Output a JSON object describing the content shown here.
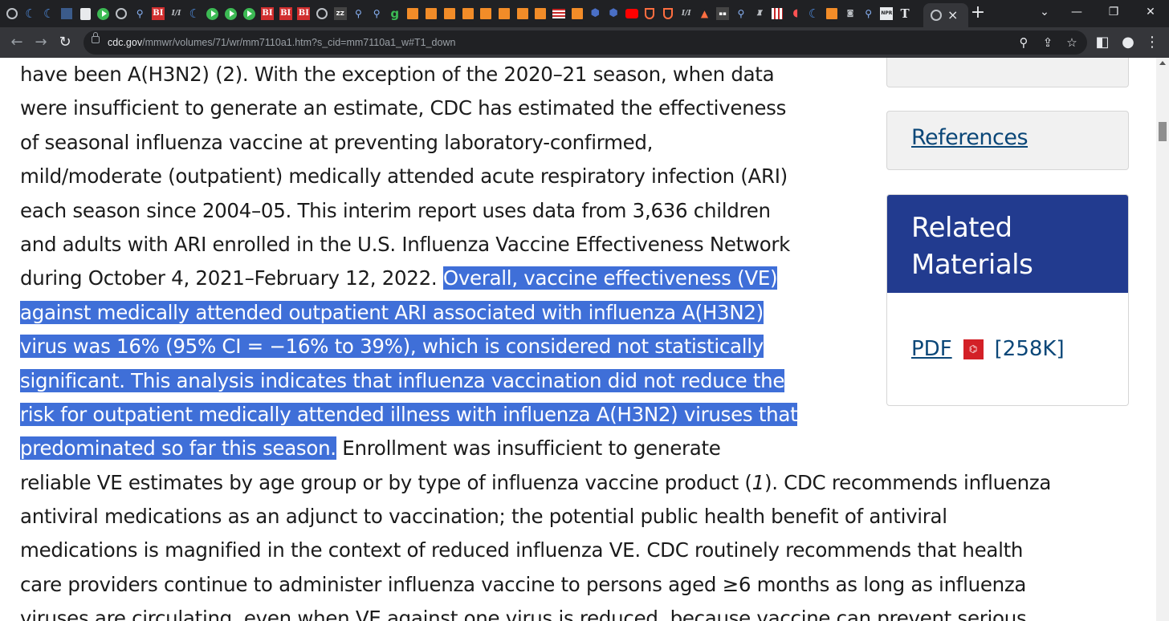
{
  "browser": {
    "pinned_tabs": [
      {
        "icon": "globe-icon",
        "text": ""
      },
      {
        "icon": "cdc-icon",
        "text": "☾"
      },
      {
        "icon": "cdc-icon",
        "text": "☾"
      },
      {
        "icon": "flag-icon",
        "text": ""
      },
      {
        "icon": "sheet-icon",
        "text": ""
      },
      {
        "icon": "play-icon",
        "text": ""
      },
      {
        "icon": "globe-icon",
        "text": ""
      },
      {
        "icon": "search-icon",
        "text": "⚲"
      },
      {
        "icon": "bi-icon",
        "text": "BI"
      },
      {
        "icon": "italic-icon",
        "text": "I/I"
      },
      {
        "icon": "cdc-icon",
        "text": "☾"
      },
      {
        "icon": "play-icon",
        "text": ""
      },
      {
        "icon": "play-icon",
        "text": ""
      },
      {
        "icon": "play-icon",
        "text": ""
      },
      {
        "icon": "bi-icon",
        "text": "BI"
      },
      {
        "icon": "bi-icon",
        "text": "BI"
      },
      {
        "icon": "bi-icon",
        "text": "BI"
      },
      {
        "icon": "globe-icon",
        "text": ""
      },
      {
        "icon": "dark-icon",
        "text": "ZZ"
      },
      {
        "icon": "search-icon",
        "text": "⚲"
      },
      {
        "icon": "search-icon",
        "text": "⚲"
      },
      {
        "icon": "g-icon",
        "text": "g"
      },
      {
        "icon": "bookmark-icon",
        "text": ""
      },
      {
        "icon": "bookmark-icon",
        "text": ""
      },
      {
        "icon": "bookmark-icon",
        "text": ""
      },
      {
        "icon": "bookmark-icon",
        "text": ""
      },
      {
        "icon": "bookmark-icon",
        "text": ""
      },
      {
        "icon": "bookmark-icon",
        "text": ""
      },
      {
        "icon": "bookmark-icon",
        "text": ""
      },
      {
        "icon": "bookmark-icon",
        "text": ""
      },
      {
        "icon": "usflag-icon",
        "text": ""
      },
      {
        "icon": "bookmark-icon",
        "text": ""
      },
      {
        "icon": "hex-icon",
        "text": "⬢"
      },
      {
        "icon": "hex-icon",
        "text": "⬢"
      },
      {
        "icon": "youtube-icon",
        "text": ""
      },
      {
        "icon": "shield-icon",
        "text": ""
      },
      {
        "icon": "shield-icon",
        "text": ""
      },
      {
        "icon": "italic-icon",
        "text": "I/I"
      },
      {
        "icon": "fire-icon",
        "text": "▲"
      },
      {
        "icon": "dark-icon",
        "text": "▪▪"
      },
      {
        "icon": "search-icon",
        "text": "⚲"
      },
      {
        "icon": "italic-icon",
        "text": "♜"
      },
      {
        "icon": "bars-icon",
        "text": ""
      },
      {
        "icon": "red-icon",
        "text": "◖"
      },
      {
        "icon": "cdc-icon",
        "text": "☾"
      },
      {
        "icon": "bookmark-icon",
        "text": ""
      },
      {
        "icon": "italic-icon",
        "text": "◙"
      },
      {
        "icon": "search-icon",
        "text": "⚲"
      },
      {
        "icon": "bw-icon",
        "text": "NPR"
      },
      {
        "icon": "nyt-icon",
        "text": "T"
      }
    ],
    "active_tab": {
      "icon": "globe-icon",
      "close": "×"
    },
    "new_tab": "+",
    "tab_search": "⌄",
    "window_controls": {
      "minimize": "—",
      "restore": "❐",
      "close": "✕"
    },
    "nav": {
      "back": "←",
      "forward": "→",
      "reload": "↻"
    },
    "url": {
      "host": "cdc.gov",
      "path": "/mmwr/volumes/71/wr/mm7110a1.htm?s_cid=mm7110a1_w#T1_down"
    },
    "omnibox_icons": {
      "zoom": "⚲",
      "share": "⇪",
      "bookmark": "☆"
    },
    "toolbar_icons": {
      "sidepanel": "◧",
      "profile": "●",
      "menu": "⋮"
    }
  },
  "article": {
    "lines": [
      [
        {
          "t": "have been A(H3N2) (2). With the exception of the 2020–21 season, when data"
        }
      ],
      [
        {
          "t": "were insufficient to generate an estimate, CDC has estimated the effectiveness"
        }
      ],
      [
        {
          "t": "of seasonal influenza vaccine at preventing laboratory-confirmed,"
        }
      ],
      [
        {
          "t": "mild/moderate (outpatient) medically attended acute respiratory infection (ARI)"
        }
      ],
      [
        {
          "t": "each season since 2004–05. This interim report uses data from 3,636 children"
        }
      ],
      [
        {
          "t": "and adults with ARI enrolled in the U.S. Influenza Vaccine Effectiveness Network"
        }
      ],
      [
        {
          "t": "during October 4, 2021–February 12, 2022. "
        },
        {
          "t": "Overall, vaccine effectiveness (VE)",
          "hl": true
        }
      ],
      [
        {
          "t": "against medically attended outpatient ARI associated with influenza A(H3N2)",
          "hl": true
        }
      ],
      [
        {
          "t": "virus was 16% (95% CI = −16% to 39%), which is considered not statistically",
          "hl": true
        }
      ],
      [
        {
          "t": "significant. This analysis indicates that influenza vaccination did not reduce the",
          "hl": true
        }
      ],
      [
        {
          "t": "risk for outpatient medically attended illness with influenza A(H3N2) viruses that",
          "hl": true
        }
      ],
      [
        {
          "t": "predominated so far this season.",
          "hl": true
        },
        {
          "t": " Enrollment was insufficient to generate"
        }
      ],
      [
        {
          "t": "reliable VE estimates by age group or by type of influenza vaccine product ("
        },
        {
          "t": "1",
          "it": true
        },
        {
          "t": "). CDC recommends influenza"
        }
      ],
      [
        {
          "t": "antiviral medications as an adjunct to vaccination; the potential public health benefit of antiviral"
        }
      ],
      [
        {
          "t": "medications is magnified in the context of reduced influenza VE. CDC routinely recommends that health"
        }
      ],
      [
        {
          "t": "care providers continue to administer influenza vaccine to persons aged ≥6 months as long as influenza"
        }
      ],
      [
        {
          "t": "viruses are circulating, even when VE against one virus is reduced, because vaccine can prevent serious"
        }
      ]
    ]
  },
  "sidebar": {
    "references_label": "References",
    "related_title": "Related Materials",
    "pdf_label": "PDF",
    "pdf_icon_text": "⌬",
    "pdf_size": "[258K]"
  },
  "colors": {
    "highlight": "#3f6fd8",
    "related_header": "#223b8f",
    "link": "#0b4778"
  }
}
